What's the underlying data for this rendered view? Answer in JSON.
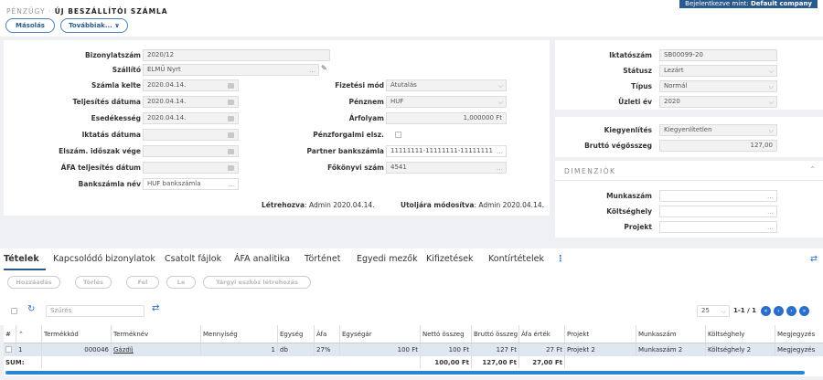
{
  "header": {
    "breadcrumb_section": "PÉNZÜGY",
    "breadcrumb_sep": "·",
    "breadcrumb_page": "ÚJ BESZÁLLÍTÓI SZÁMLA",
    "login_prefix": "Bejelentkezve mint:",
    "login_user": "Default company"
  },
  "actions": {
    "copy": "Másolás",
    "more": "Továbbiak... ∨"
  },
  "form": {
    "bizonylatszam": {
      "label": "Bizonylatszám",
      "value": "2020/12"
    },
    "szallito": {
      "label": "Szállító",
      "value": "ELMŰ Nyrt"
    },
    "szamla_kelte": {
      "label": "Számla kelte",
      "value": "2020.04.14."
    },
    "teljesites": {
      "label": "Teljesítés dátuma",
      "value": "2020.04.14."
    },
    "esedekesseg": {
      "label": "Esedékesség",
      "value": "2020.04.14."
    },
    "iktatas": {
      "label": "Iktatás dátuma",
      "value": ""
    },
    "elszam": {
      "label": "Elszám. időszak vége",
      "value": ""
    },
    "afa_telj": {
      "label": "ÁFA teljesítés dátum",
      "value": ""
    },
    "bankszamla": {
      "label": "Bankszámla név",
      "value": "HUF bankszámla"
    },
    "fizetesi": {
      "label": "Fizetési mód",
      "value": "Átutalás"
    },
    "penznem": {
      "label": "Pénznem",
      "value": "HUF"
    },
    "arfolyam": {
      "label": "Árfolyam",
      "value": "1,000000 Ft"
    },
    "penzforgalmi": {
      "label": "Pénzforgalmi elsz."
    },
    "partner_bank": {
      "label": "Partner bankszámla",
      "value": "11111111-11111111-11111111"
    },
    "fokonyvi": {
      "label": "Főkönyvi szám",
      "value": "4541"
    },
    "letrehozva_label": "Létrehozva",
    "letrehozva_value": ": Admin 2020.04.14.",
    "utoljara_label": "Utoljára módosítva",
    "utoljara_value": ": Admin 2020.04.14."
  },
  "side": {
    "iktatoszam": {
      "label": "Iktatószám",
      "value": "SB00099-20"
    },
    "statusz": {
      "label": "Státusz",
      "value": "Lezárt"
    },
    "tipus": {
      "label": "Típus",
      "value": "Normál"
    },
    "uzleti_ev": {
      "label": "Üzleti év",
      "value": "2020"
    },
    "kiegyenlites": {
      "label": "Kiegyenlítés",
      "value": "Kiegyenlítetlen"
    },
    "brutto": {
      "label": "Bruttó végösszeg",
      "value": "127,00"
    },
    "dimenziok": "DIMENZIÓK",
    "munkaszam": "Munkaszám",
    "koltseghely": "Költséghely",
    "projekt": "Projekt"
  },
  "tabs": [
    "Tételek",
    "Kapcsolódó bizonylatok",
    "Csatolt fájlok",
    "ÁFA analitika",
    "Történet",
    "Egyedi mezők",
    "Kifizetések",
    "Kontírtételek"
  ],
  "toolbar": {
    "add": "Hozzáadás",
    "delete": "Törlés",
    "up": "Fel",
    "down": "Le",
    "create": "Tárgyi eszköz létrehozás",
    "filter_placeholder": "Szűrés",
    "page_size": "25",
    "page_info": "1-1 / 1"
  },
  "table": {
    "headers": {
      "num": "#",
      "code": "Termékkód",
      "name": "Terméknév",
      "qty": "Mennyiség",
      "unit": "Egység",
      "vat": "Áfa",
      "price": "Egységár",
      "net": "Nettó összeg",
      "gross": "Bruttó összeg",
      "vatval": "Áfa érték",
      "project": "Projekt",
      "worknum": "Munkaszám",
      "costcenter": "Költséghely",
      "note": "Megjegyzés"
    },
    "row": {
      "num": "1",
      "code": "000046",
      "name": "Gázdíj",
      "qty": "1",
      "unit": "db",
      "vat": "27%",
      "price": "100 Ft",
      "net": "100 Ft",
      "gross": "127 Ft",
      "vatval": "27 Ft",
      "project": "Projekt 2",
      "worknum": "Munkaszám 2",
      "costcenter": "Költséghely 2",
      "note": "Megjegyzés"
    },
    "sum": {
      "label": "SUM:",
      "net": "100,00 Ft",
      "gross": "127,00 Ft",
      "vatval": "27,00 Ft"
    }
  }
}
